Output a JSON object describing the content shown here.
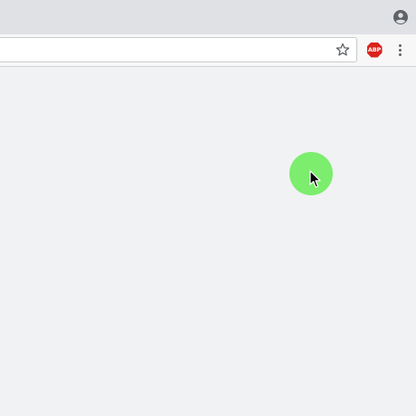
{
  "browser": {
    "address_bar": {
      "value": "",
      "placeholder": ""
    },
    "extension": {
      "abp_label": "ABP"
    },
    "icons": {
      "profile": "account-circle-icon",
      "bookmark": "star-outline-icon",
      "extension": "adblock-plus-icon",
      "menu": "three-dots-vertical-icon"
    }
  },
  "cursor": {
    "type": "arrow-pointer",
    "highlight_color": "#7ced6d"
  },
  "colors": {
    "titlebar": "#dfe1e5",
    "toolbar": "#f7f7f7",
    "page_background": "#f1f2f4",
    "abp_red": "#d9231c"
  }
}
